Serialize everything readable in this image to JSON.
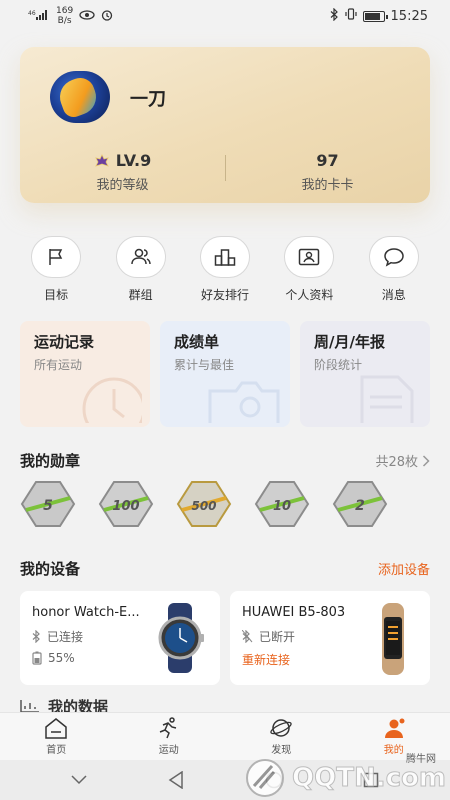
{
  "status_bar": {
    "signal": "46",
    "net_speed_value": "169",
    "net_speed_unit": "B/s",
    "time": "15:25",
    "battery_level": 0.9
  },
  "profile": {
    "username": "一刀",
    "level_value": "LV.9",
    "level_label": "我的等级",
    "cards_value": "97",
    "cards_label": "我的卡卡"
  },
  "actions": [
    {
      "label": "目标"
    },
    {
      "label": "群组"
    },
    {
      "label": "好友排行"
    },
    {
      "label": "个人资料"
    },
    {
      "label": "消息"
    }
  ],
  "tiles": [
    {
      "title": "运动记录",
      "sub": "所有运动"
    },
    {
      "title": "成绩单",
      "sub": "累计与最佳"
    },
    {
      "title": "周/月/年报",
      "sub": "阶段统计"
    }
  ],
  "medals": {
    "title": "我的勋章",
    "count": "共28枚",
    "items": [
      "5",
      "100",
      "500",
      "10",
      "2"
    ]
  },
  "devices": {
    "title": "我的设备",
    "add": "添加设备",
    "items": [
      {
        "name": "honor Watch-E...",
        "status": "已连接",
        "battery": "55%"
      },
      {
        "name": "HUAWEI B5-803",
        "status": "已断开",
        "action": "重新连接"
      }
    ]
  },
  "data_section": {
    "title": "我的数据"
  },
  "tabs": [
    {
      "label": "首页"
    },
    {
      "label": "运动"
    },
    {
      "label": "发现"
    },
    {
      "label": "我的"
    }
  ],
  "watermark": {
    "text": "QQTN.com",
    "sub": "腾牛网"
  },
  "colors": {
    "accent": "#e8641e",
    "card_gold": "#efdcb6"
  }
}
